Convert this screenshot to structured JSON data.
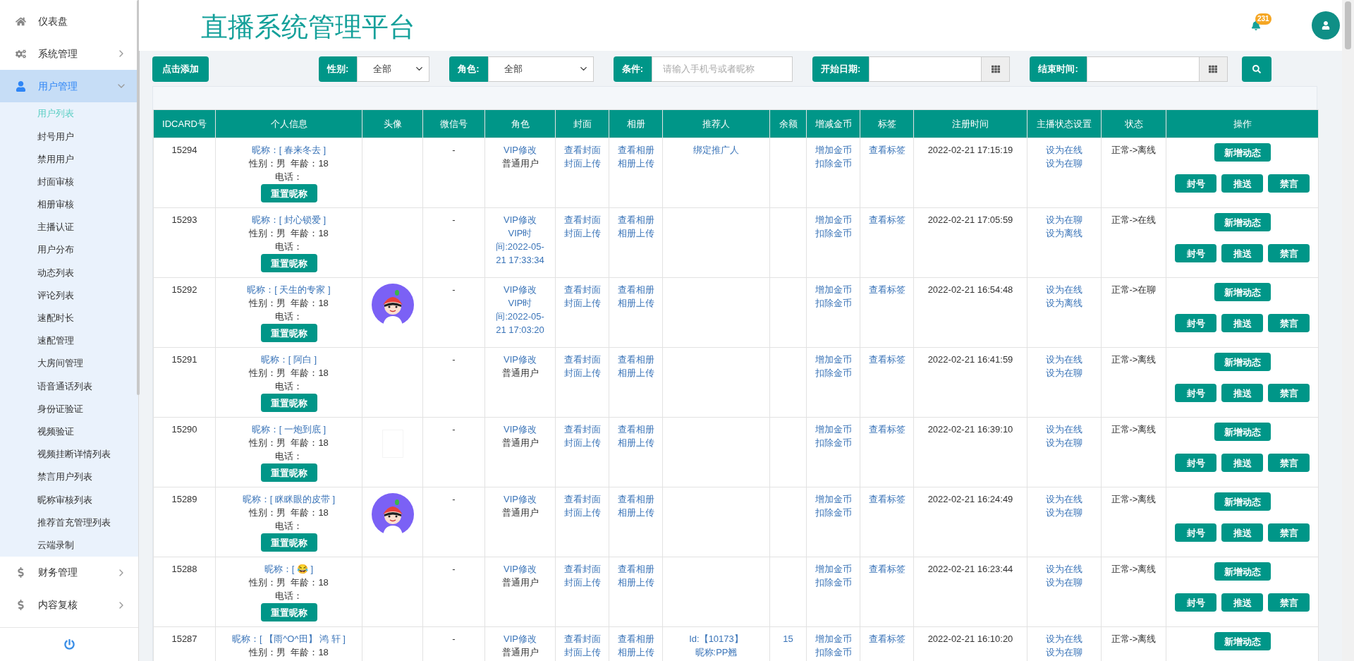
{
  "sidebar": {
    "items": [
      {
        "label": "仪表盘",
        "kind": "home",
        "has_arrow": false,
        "selected": false
      },
      {
        "label": "系统管理",
        "kind": "cogs",
        "has_arrow": true,
        "expanded": false,
        "selected": false
      },
      {
        "label": "用户管理",
        "kind": "user",
        "has_arrow": true,
        "expanded": true,
        "selected": true,
        "children": [
          {
            "label": "用户列表",
            "selected": true
          },
          {
            "label": "封号用户",
            "selected": false
          },
          {
            "label": "禁用用户",
            "selected": false
          },
          {
            "label": "封面审核",
            "selected": false
          },
          {
            "label": "相册审核",
            "selected": false
          },
          {
            "label": "主播认证",
            "selected": false
          },
          {
            "label": "用户分布",
            "selected": false
          },
          {
            "label": "动态列表",
            "selected": false
          },
          {
            "label": "评论列表",
            "selected": false
          },
          {
            "label": "速配时长",
            "selected": false
          },
          {
            "label": "速配管理",
            "selected": false
          },
          {
            "label": "大房间管理",
            "selected": false
          },
          {
            "label": "语音通话列表",
            "selected": false
          },
          {
            "label": "身份证验证",
            "selected": false
          },
          {
            "label": "视频验证",
            "selected": false
          },
          {
            "label": "视频挂断详情列表",
            "selected": false
          },
          {
            "label": "禁言用户列表",
            "selected": false
          },
          {
            "label": "昵称审核列表",
            "selected": false
          },
          {
            "label": "推荐首充管理列表",
            "selected": false
          },
          {
            "label": "云端录制",
            "selected": false
          }
        ]
      },
      {
        "label": "财务管理",
        "kind": "dollar",
        "has_arrow": true,
        "expanded": false,
        "selected": false
      },
      {
        "label": "内容复核",
        "kind": "dollar",
        "has_arrow": true,
        "expanded": false,
        "selected": false
      }
    ]
  },
  "header": {
    "title": "直播系统管理平台",
    "notification_count": "231"
  },
  "toolbar": {
    "add_button": "点击添加",
    "filters": [
      {
        "kind": "select",
        "label": "性别:",
        "value": "全部"
      },
      {
        "kind": "select",
        "label": "角色:",
        "value": "全部"
      },
      {
        "kind": "text",
        "label": "条件:",
        "placeholder": "请输入手机号或者昵称"
      },
      {
        "kind": "date",
        "label": "开始日期:"
      },
      {
        "kind": "date",
        "label": "结束时间:"
      }
    ]
  },
  "table": {
    "columns": [
      "IDCARD号",
      "个人信息",
      "头像",
      "微信号",
      "角色",
      "封面",
      "相册",
      "推荐人",
      "余额",
      "增减金币",
      "标签",
      "注册时间",
      "主播状态设置",
      "状态",
      "操作"
    ],
    "rows": [
      {
        "id": "15294",
        "nickname": "昵称：[ 春来冬去 ]",
        "gender_age": "性别：男  年龄：18",
        "phone": "电话：",
        "reset": "重置昵称",
        "wechat": "-",
        "role_edit": "VIP修改",
        "role_status": "普通用户",
        "vip": false,
        "cover": [
          "查看封面",
          "封面上传"
        ],
        "album": [
          "查看相册",
          "相册上传"
        ],
        "referrer": [
          "绑定推广人"
        ],
        "balance": "",
        "coins": [
          "增加金币",
          "扣除金币"
        ],
        "tag": "查看标签",
        "time": "2022-02-21 17:15:19",
        "anchor": [
          "设为在线",
          "设为在聊"
        ],
        "status": "正常->离线",
        "new_post": "新增动态",
        "actions": [
          "封号",
          "推送",
          "禁言"
        ]
      },
      {
        "id": "15293",
        "nickname": "昵称：[ 封心锁爱 ]",
        "gender_age": "性别：男  年龄：18",
        "phone": "电话：",
        "reset": "重置昵称",
        "wechat": "-",
        "role_edit": "VIP修改",
        "role_status": "VIP时间:2022-05-21 17:33:34",
        "vip": true,
        "cover": [
          "查看封面",
          "封面上传"
        ],
        "album": [
          "查看相册",
          "相册上传"
        ],
        "referrer": [],
        "balance": "",
        "coins": [
          "增加金币",
          "扣除金币"
        ],
        "tag": "查看标签",
        "time": "2022-02-21 17:05:59",
        "anchor": [
          "设为在聊",
          "设为离线"
        ],
        "status": "正常->在线",
        "new_post": "新增动态",
        "actions": [
          "封号",
          "推送",
          "禁言"
        ]
      },
      {
        "id": "15292",
        "nickname": "昵称：[ 天生的专家 ]",
        "gender_age": "性别：男  年龄：18",
        "phone": "电话：",
        "reset": "重置昵称",
        "avatar": {
          "kind": "cartoon"
        },
        "wechat": "-",
        "role_edit": "VIP修改",
        "role_status": "VIP时间:2022-05-21 17:03:20",
        "vip": true,
        "cover": [
          "查看封面",
          "封面上传"
        ],
        "album": [
          "查看相册",
          "相册上传"
        ],
        "referrer": [],
        "balance": "",
        "coins": [
          "增加金币",
          "扣除金币"
        ],
        "tag": "查看标签",
        "time": "2022-02-21 16:54:48",
        "anchor": [
          "设为在线",
          "设为离线"
        ],
        "status": "正常->在聊",
        "new_post": "新增动态",
        "actions": [
          "封号",
          "推送",
          "禁言"
        ]
      },
      {
        "id": "15291",
        "nickname": "昵称：[ 阿白 ]",
        "gender_age": "性别：男  年龄：18",
        "phone": "电话：",
        "reset": "重置昵称",
        "wechat": "-",
        "role_edit": "VIP修改",
        "role_status": "普通用户",
        "vip": false,
        "cover": [
          "查看封面",
          "封面上传"
        ],
        "album": [
          "查看相册",
          "相册上传"
        ],
        "referrer": [],
        "balance": "",
        "coins": [
          "增加金币",
          "扣除金币"
        ],
        "tag": "查看标签",
        "time": "2022-02-21 16:41:59",
        "anchor": [
          "设为在线",
          "设为在聊"
        ],
        "status": "正常->离线",
        "new_post": "新增动态",
        "actions": [
          "封号",
          "推送",
          "禁言"
        ]
      },
      {
        "id": "15290",
        "nickname": "昵称：[ 一炮到底 ]",
        "gender_age": "性别：男  年龄：18",
        "phone": "电话：",
        "reset": "重置昵称",
        "avatar": {
          "kind": "blank"
        },
        "wechat": "-",
        "role_edit": "VIP修改",
        "role_status": "普通用户",
        "vip": false,
        "cover": [
          "查看封面",
          "封面上传"
        ],
        "album": [
          "查看相册",
          "相册上传"
        ],
        "referrer": [],
        "balance": "",
        "coins": [
          "增加金币",
          "扣除金币"
        ],
        "tag": "查看标签",
        "time": "2022-02-21 16:39:10",
        "anchor": [
          "设为在线",
          "设为在聊"
        ],
        "status": "正常->离线",
        "new_post": "新增动态",
        "actions": [
          "封号",
          "推送",
          "禁言"
        ]
      },
      {
        "id": "15289",
        "nickname": "昵称：[ 眯眯眼的皮带 ]",
        "gender_age": "性别：男  年龄：18",
        "phone": "电话：",
        "reset": "重置昵称",
        "avatar": {
          "kind": "cartoon"
        },
        "wechat": "-",
        "role_edit": "VIP修改",
        "role_status": "普通用户",
        "vip": false,
        "cover": [
          "查看封面",
          "封面上传"
        ],
        "album": [
          "查看相册",
          "相册上传"
        ],
        "referrer": [],
        "balance": "",
        "coins": [
          "增加金币",
          "扣除金币"
        ],
        "tag": "查看标签",
        "time": "2022-02-21 16:24:49",
        "anchor": [
          "设为在线",
          "设为在聊"
        ],
        "status": "正常->离线",
        "new_post": "新增动态",
        "actions": [
          "封号",
          "推送",
          "禁言"
        ]
      },
      {
        "id": "15288",
        "nickname": "昵称：[ 😂 ]",
        "gender_age": "性别：男  年龄：18",
        "phone": "电话：",
        "reset": "重置昵称",
        "wechat": "-",
        "role_edit": "VIP修改",
        "role_status": "普通用户",
        "vip": false,
        "cover": [
          "查看封面",
          "封面上传"
        ],
        "album": [
          "查看相册",
          "相册上传"
        ],
        "referrer": [],
        "balance": "",
        "coins": [
          "增加金币",
          "扣除金币"
        ],
        "tag": "查看标签",
        "time": "2022-02-21 16:23:44",
        "anchor": [
          "设为在线",
          "设为在聊"
        ],
        "status": "正常->离线",
        "new_post": "新增动态",
        "actions": [
          "封号",
          "推送",
          "禁言"
        ]
      },
      {
        "id": "15287",
        "nickname": "昵称：[ 【雨^O^田】 鸿 轩 ]",
        "gender_age": "性别：男  年龄：18",
        "wechat": "-",
        "role_edit": "VIP修改",
        "role_status": "普通用户",
        "vip": false,
        "cover": [
          "查看封面",
          "封面上传"
        ],
        "album": [
          "查看相册",
          "相册上传"
        ],
        "referrer": [
          "Id:【10173】",
          "昵称:PP翘"
        ],
        "balance": "15",
        "coins": [
          "增加金币",
          "扣除金币"
        ],
        "tag": "查看标签",
        "time": "2022-02-21 16:10:20",
        "anchor": [
          "设为在线",
          "设为在聊"
        ],
        "status": "正常->离线",
        "new_post": "新增动态",
        "actions": []
      }
    ]
  }
}
